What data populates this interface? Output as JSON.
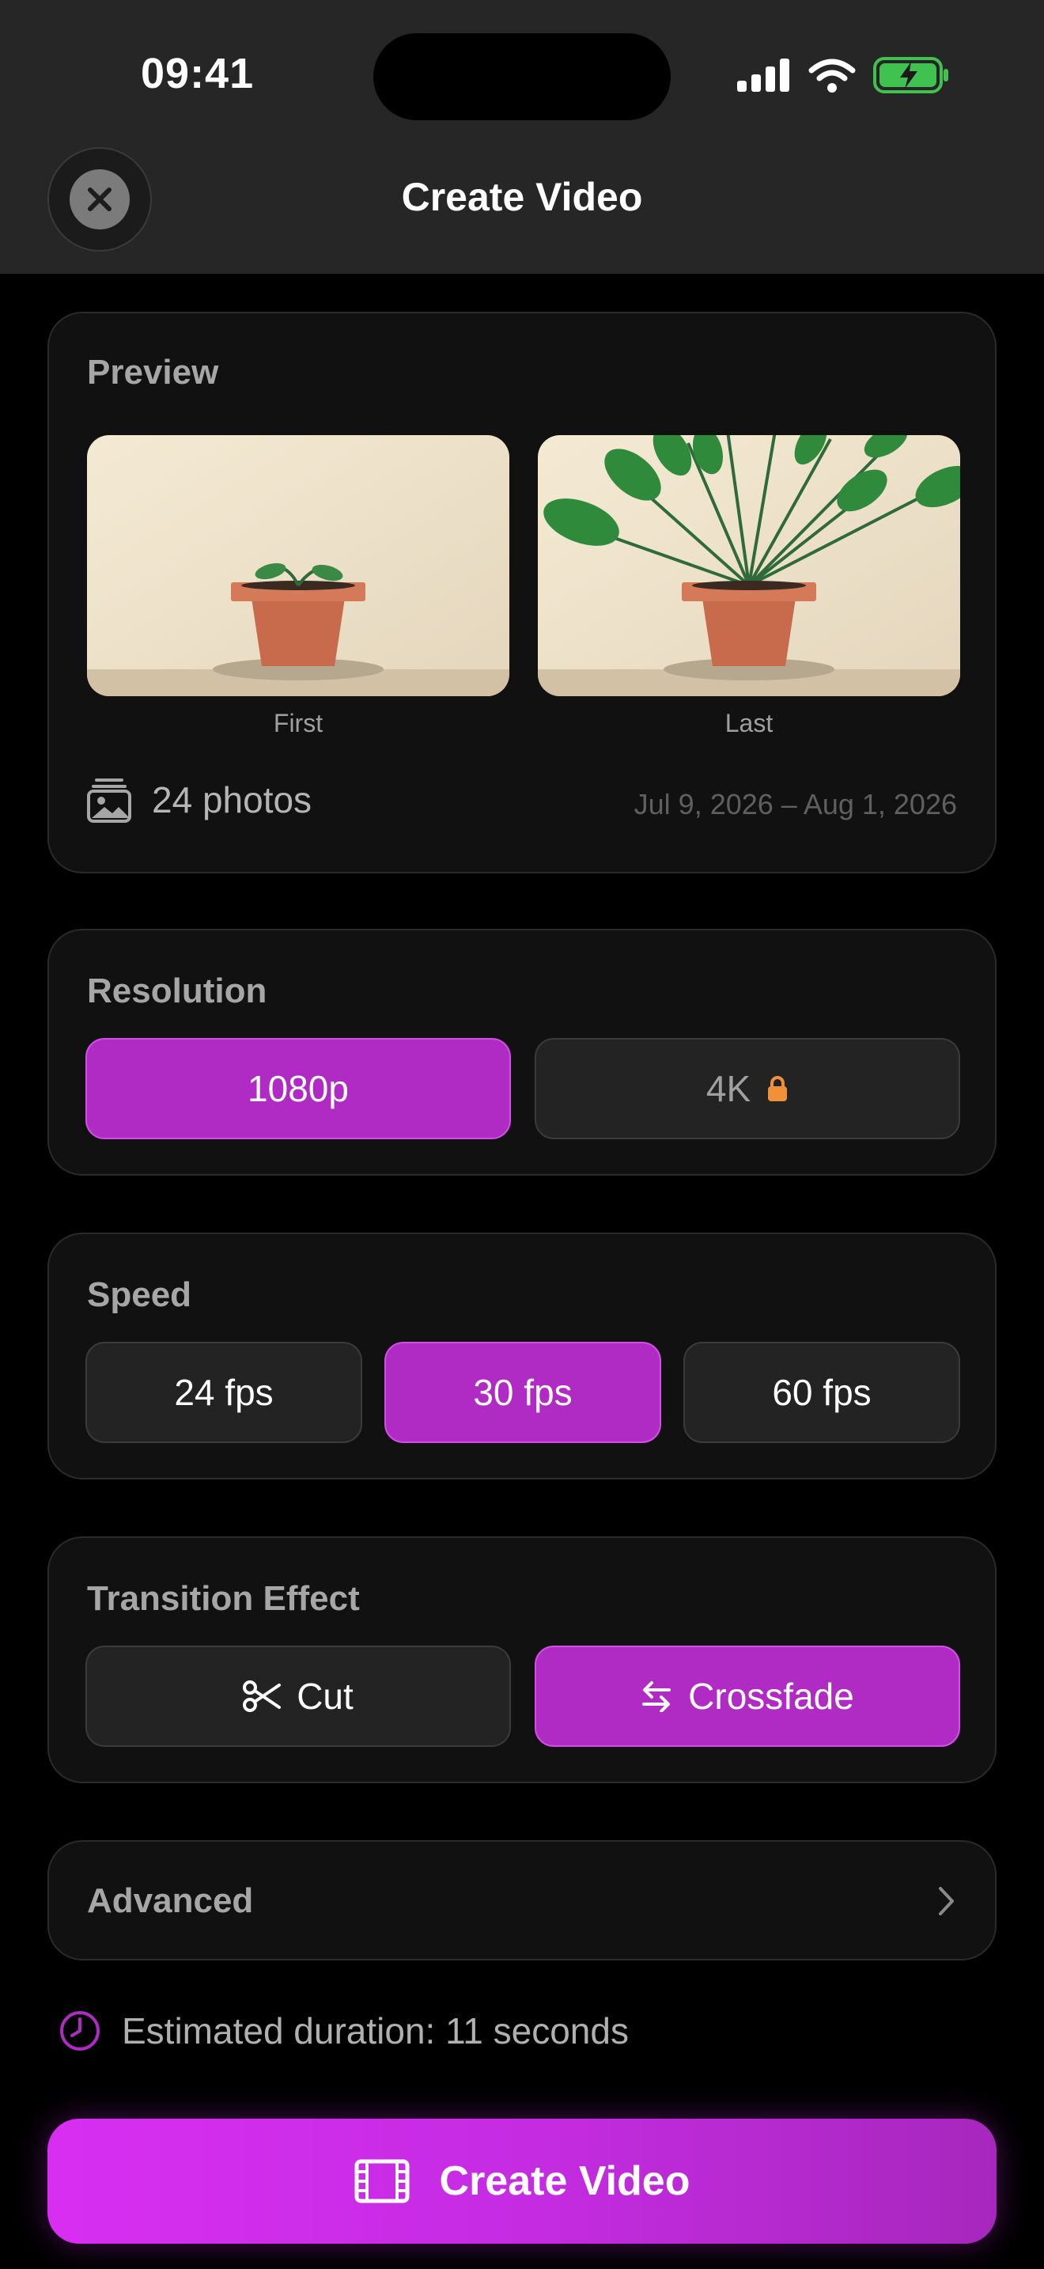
{
  "status_bar": {
    "time": "09:41"
  },
  "header": {
    "title": "Create Video",
    "close_icon": "close-icon"
  },
  "preview": {
    "title": "Preview",
    "first_label": "First",
    "last_label": "Last",
    "photos_count": "24 photos",
    "date_range": "Jul 9, 2026 – Aug 1, 2026"
  },
  "resolution": {
    "title": "Resolution",
    "options": [
      {
        "label": "1080p",
        "selected": true
      },
      {
        "label": "4K",
        "selected": false,
        "locked": true
      }
    ]
  },
  "speed": {
    "title": "Speed",
    "options": [
      {
        "label": "24 fps",
        "selected": false
      },
      {
        "label": "30 fps",
        "selected": true
      },
      {
        "label": "60 fps",
        "selected": false
      }
    ]
  },
  "transition": {
    "title": "Transition Effect",
    "options": [
      {
        "label": "Cut",
        "icon": "scissors-icon",
        "selected": false
      },
      {
        "label": "Crossfade",
        "icon": "crossfade-arrows-icon",
        "selected": true
      }
    ]
  },
  "advanced": {
    "label": "Advanced"
  },
  "estimate": {
    "text": "Estimated duration: 11 seconds"
  },
  "create_button": {
    "label": "Create Video",
    "icon": "film-icon"
  },
  "colors": {
    "accent": "#b02bc4",
    "lock": "#f0913a",
    "battery": "#3fc24f"
  }
}
